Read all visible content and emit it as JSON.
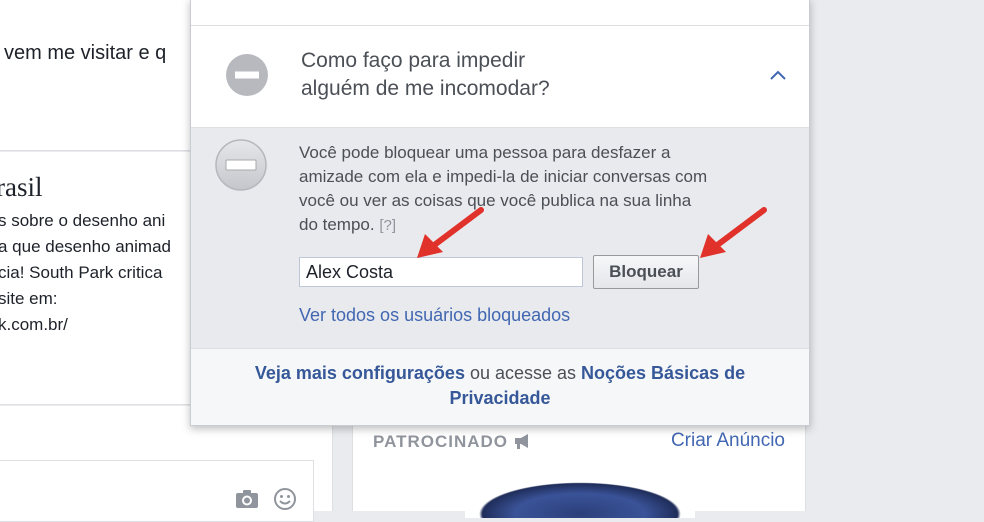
{
  "feed": {
    "post_text_partial": "vem me visitar e q",
    "card_title_partial": "rasil",
    "card_lines": [
      "s sobre o desenho ani",
      "a que desenho animad",
      "cia! South Park critica",
      "site em:",
      "k.com.br/"
    ]
  },
  "panel": {
    "question": {
      "line1": "Como faço para impedir",
      "line2": "alguém de me incomodar?"
    },
    "description": "Você pode bloquear uma pessoa para desfazer a amizade com ela e impedi-la de iniciar conversas com você ou ver as coisas que você publica na sua linha do tempo.",
    "help_link": "[?]",
    "name_input_value": "Alex Costa",
    "block_button": "Bloquear",
    "see_all_link": "Ver todos os usuários bloqueados",
    "footer": {
      "link1": "Veja mais configurações",
      "middle": " ou acesse as ",
      "link2": "Noções Básicas de Privacidade"
    }
  },
  "right_column": {
    "sponsored_label": "PATROCINADO",
    "create_ad_link": "Criar Anúncio"
  },
  "colors": {
    "link": "#4267b2",
    "arrow": "#e0322b",
    "panel_bg": "#e9eaed"
  }
}
